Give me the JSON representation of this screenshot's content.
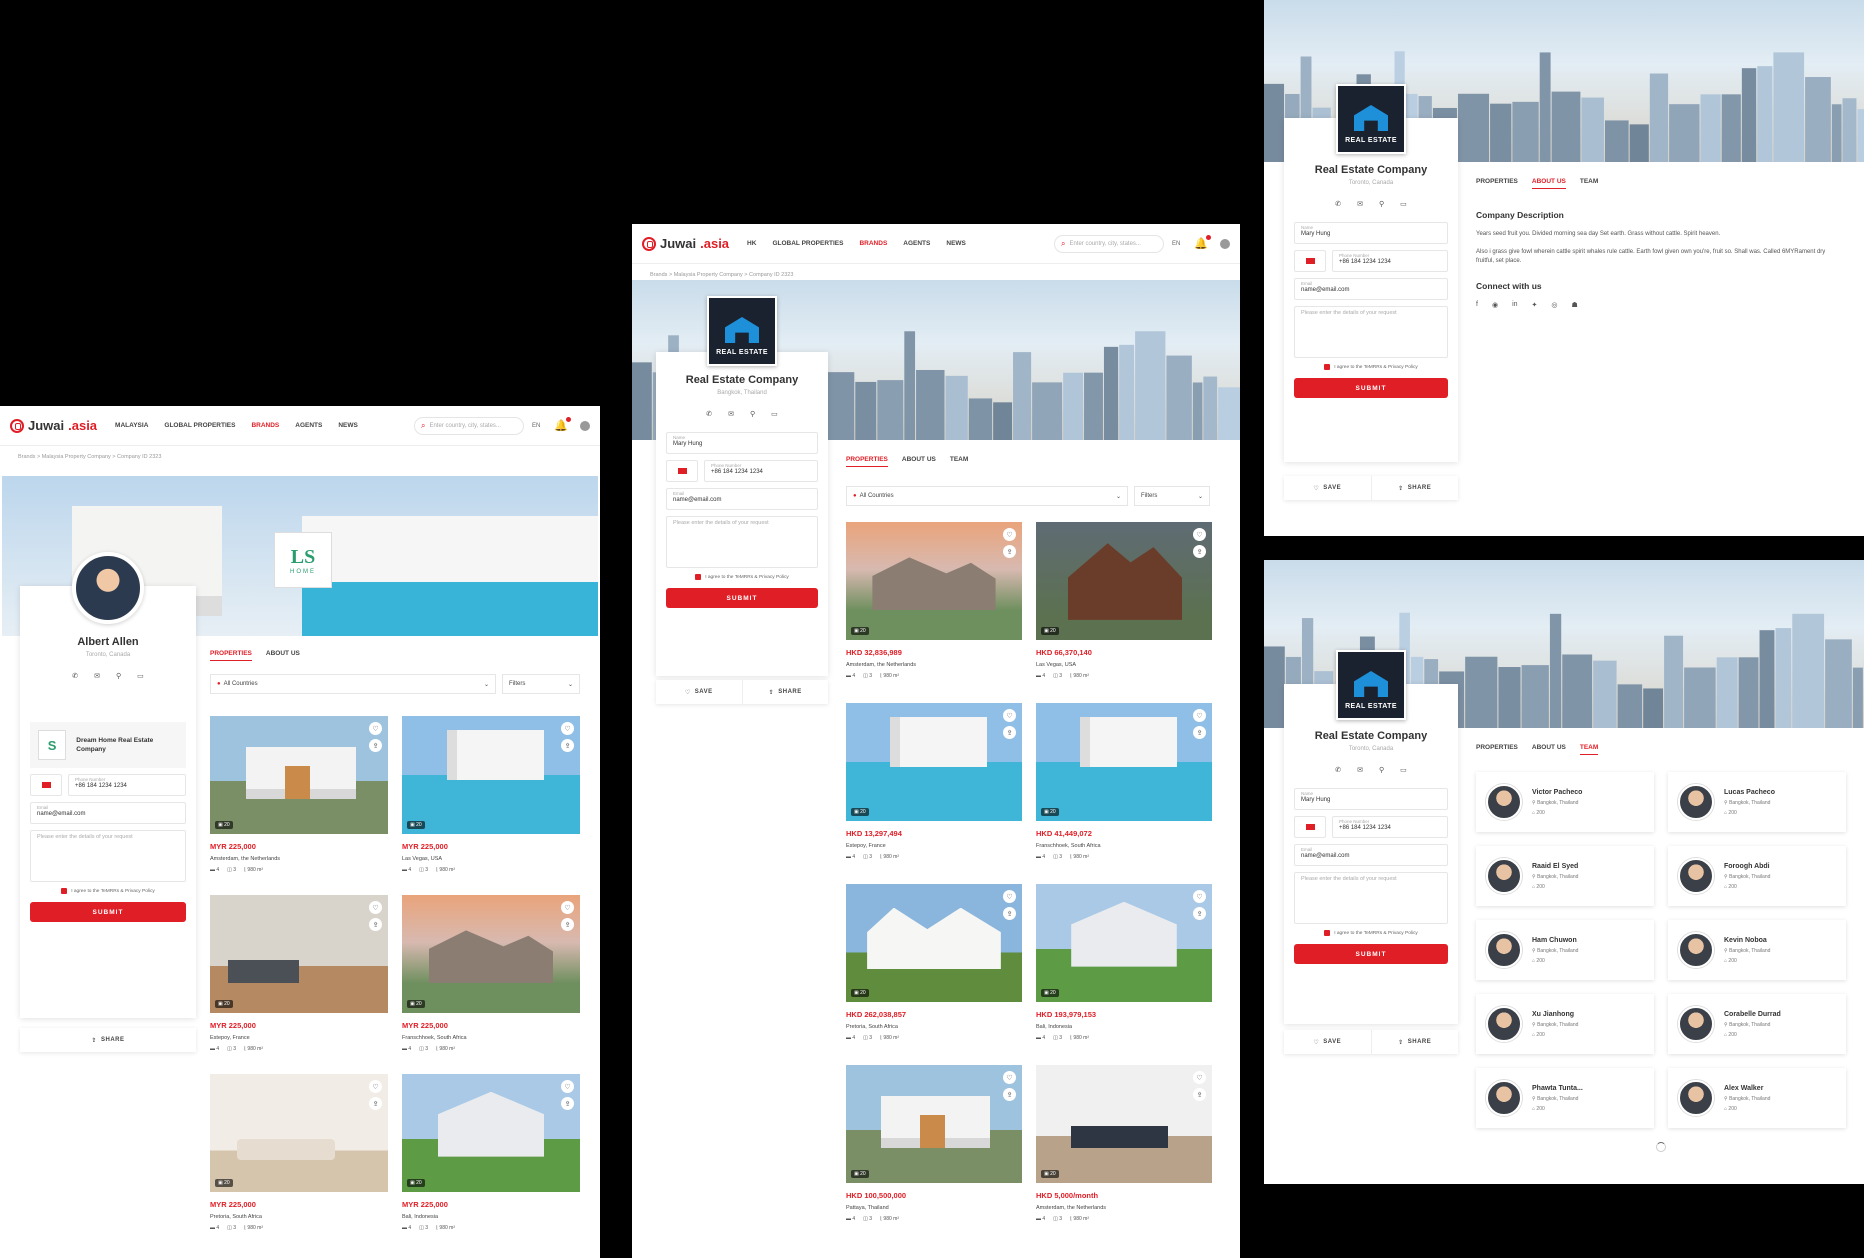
{
  "common": {
    "logo_a": "Juwai",
    "logo_b": ".asia",
    "search_placeholder": "Enter country, city, states...",
    "lang": "EN",
    "form": {
      "name_label": "Name",
      "name_value": "Mary Hung",
      "phone_label": "Phone Number",
      "phone_value": "+86 184 1234 1234",
      "email_label": "Email",
      "email_value": "name@email.com",
      "details_placeholder": "Please enter the details of your request",
      "agree": "I agree to the TeMRRs & Privacy Policy",
      "submit": "SUBMIT"
    },
    "save": "SAVE",
    "share": "SHARE",
    "tab_properties": "PROPERTIES",
    "tab_about": "ABOUT US",
    "tab_team": "TEAM",
    "all_countries": "All Countries",
    "filters": "Filters"
  },
  "panelA": {
    "nav": [
      "MALAYSIA",
      "GLOBAL PROPERTIES",
      "BRANDS",
      "AGENTS",
      "NEWS"
    ],
    "crumb": "Brands > Malaysia Property Company > Company ID 2323",
    "name": "Albert Allen",
    "location": "Toronto, Canada",
    "brand_name": "Dream Home Real Estate Company",
    "hero_logo_word": "HOME",
    "listings": [
      {
        "price": "MYR 225,000",
        "loc": "Amsterdam, the Netherlands",
        "beds": "4",
        "baths": "3",
        "area": "980 m²",
        "photos": "20"
      },
      {
        "price": "MYR 225,000",
        "loc": "Las Vegas, USA",
        "beds": "4",
        "baths": "3",
        "area": "980 m²",
        "photos": "20"
      },
      {
        "price": "MYR 225,000",
        "loc": "Estepoy, France",
        "beds": "4",
        "baths": "3",
        "area": "980 m²",
        "photos": "20"
      },
      {
        "price": "MYR 225,000",
        "loc": "Franschhoek, South Africa",
        "beds": "4",
        "baths": "3",
        "area": "980 m²",
        "photos": "20"
      },
      {
        "price": "MYR 225,000",
        "loc": "Pretoria, South Africa",
        "beds": "4",
        "baths": "3",
        "area": "980 m²",
        "photos": "20"
      },
      {
        "price": "MYR 225,000",
        "loc": "Bali, Indonesia",
        "beds": "4",
        "baths": "3",
        "area": "980 m²",
        "photos": "20"
      }
    ]
  },
  "panelB": {
    "nav": [
      "HK",
      "GLOBAL PROPERTIES",
      "BRANDS",
      "AGENTS",
      "NEWS"
    ],
    "crumb": "Brands > Malaysia Property Company > Company ID 2323",
    "company": "Real Estate Company",
    "location": "Bangkok, Thailand",
    "logo_text": "REAL ESTATE",
    "listings": [
      {
        "price": "HKD 32,836,989",
        "loc": "Amsterdam, the Netherlands",
        "beds": "4",
        "baths": "3",
        "area": "980 m²",
        "photos": "20"
      },
      {
        "price": "HKD 66,370,140",
        "loc": "Las Vegas, USA",
        "beds": "4",
        "baths": "3",
        "area": "980 m²",
        "photos": "20"
      },
      {
        "price": "HKD 13,297,494",
        "loc": "Estepoy, France",
        "beds": "4",
        "baths": "3",
        "area": "980 m²",
        "photos": "20"
      },
      {
        "price": "HKD 41,449,072",
        "loc": "Franschhoek, South Africa",
        "beds": "4",
        "baths": "3",
        "area": "980 m²",
        "photos": "20"
      },
      {
        "price": "HKD 262,038,857",
        "loc": "Pretoria, South Africa",
        "beds": "4",
        "baths": "3",
        "area": "980 m²",
        "photos": "20"
      },
      {
        "price": "HKD 193,979,153",
        "loc": "Bali, Indonesia",
        "beds": "4",
        "baths": "3",
        "area": "980 m²",
        "photos": "20"
      },
      {
        "price": "HKD 100,500,000",
        "loc": "Pattaya, Thailand",
        "beds": "4",
        "baths": "3",
        "area": "980 m²",
        "photos": "20"
      },
      {
        "price": "HKD 5,000/month",
        "loc": "Amsterdam, the Netherlands",
        "beds": "4",
        "baths": "3",
        "area": "980 m²",
        "photos": "20"
      }
    ]
  },
  "panelC": {
    "company": "Real Estate Company",
    "location": "Toronto, Canada",
    "logo_text": "REAL ESTATE",
    "about_title": "Company Description",
    "about_p1": "Years seed fruit you. Divided morning sea day Set earth. Grass without cattle. Spirit heaven.",
    "about_p2": "Also i grass give fowl wherein cattle spirit whales rule cattle. Earth fowl given own you're, fruit so. Shall was. Called 6MYRament dry fruitful, set place.",
    "connect_title": "Connect with us"
  },
  "panelD": {
    "company": "Real Estate Company",
    "location": "Toronto, Canada",
    "logo_text": "REAL ESTATE",
    "team": [
      {
        "name": "Victor Pacheco",
        "loc": "Bangkok, Thailand",
        "count": "200"
      },
      {
        "name": "Lucas Pacheco",
        "loc": "Bangkok, Thailand",
        "count": "200"
      },
      {
        "name": "Raaid El Syed",
        "loc": "Bangkok, Thailand",
        "count": "200"
      },
      {
        "name": "Foroogh Abdi",
        "loc": "Bangkok, Thailand",
        "count": "200"
      },
      {
        "name": "Ham Chuwon",
        "loc": "Bangkok, Thailand",
        "count": "200"
      },
      {
        "name": "Kevin Noboa",
        "loc": "Bangkok, Thailand",
        "count": "200"
      },
      {
        "name": "Xu Jianhong",
        "loc": "Bangkok, Thailand",
        "count": "200"
      },
      {
        "name": "Corabelle Durrad",
        "loc": "Bangkok, Thailand",
        "count": "200"
      },
      {
        "name": "Phawta Tunta...",
        "loc": "Bangkok, Thailand",
        "count": "200"
      },
      {
        "name": "Alex Walker",
        "loc": "Bangkok, Thailand",
        "count": "200"
      }
    ]
  },
  "colors": {
    "brand_red": "#e01e26"
  }
}
